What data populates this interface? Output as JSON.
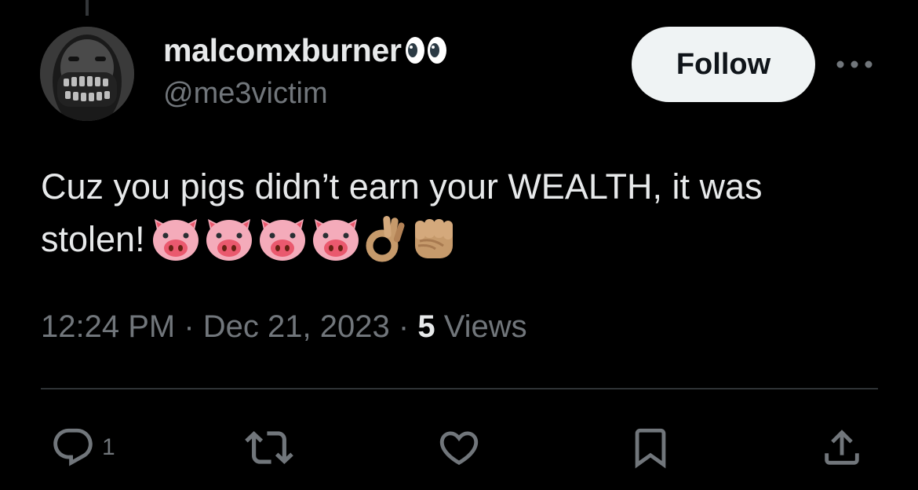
{
  "author": {
    "display_name": "malcomxburner",
    "name_emoji": "eyes-emoji",
    "handle": "@me3victim",
    "avatar": "avatar-masked-person"
  },
  "header": {
    "follow_label": "Follow",
    "more_icon": "more-horizontal-icon"
  },
  "tweet": {
    "text_line1": "Cuz you pigs didn’t earn your WEALTH, it was",
    "text_line2": "stolen!",
    "emojis": [
      "pig-face",
      "pig-face",
      "pig-face",
      "pig-face",
      "ok-hand-medium-skin",
      "raised-fist-medium-skin"
    ]
  },
  "meta": {
    "time": "12:24 PM",
    "separator": "·",
    "date": "Dec 21, 2023",
    "views_count": "5",
    "views_label": "Views"
  },
  "actions": {
    "reply_icon": "reply-icon",
    "reply_count": "1",
    "retweet_icon": "retweet-icon",
    "like_icon": "heart-icon",
    "bookmark_icon": "bookmark-icon",
    "share_icon": "share-icon"
  },
  "colors": {
    "background": "#000000",
    "primary_text": "#e7e9ea",
    "secondary_text": "#71767b",
    "divider": "#2f3336",
    "follow_bg": "#eff3f4",
    "follow_text": "#0f1419"
  }
}
